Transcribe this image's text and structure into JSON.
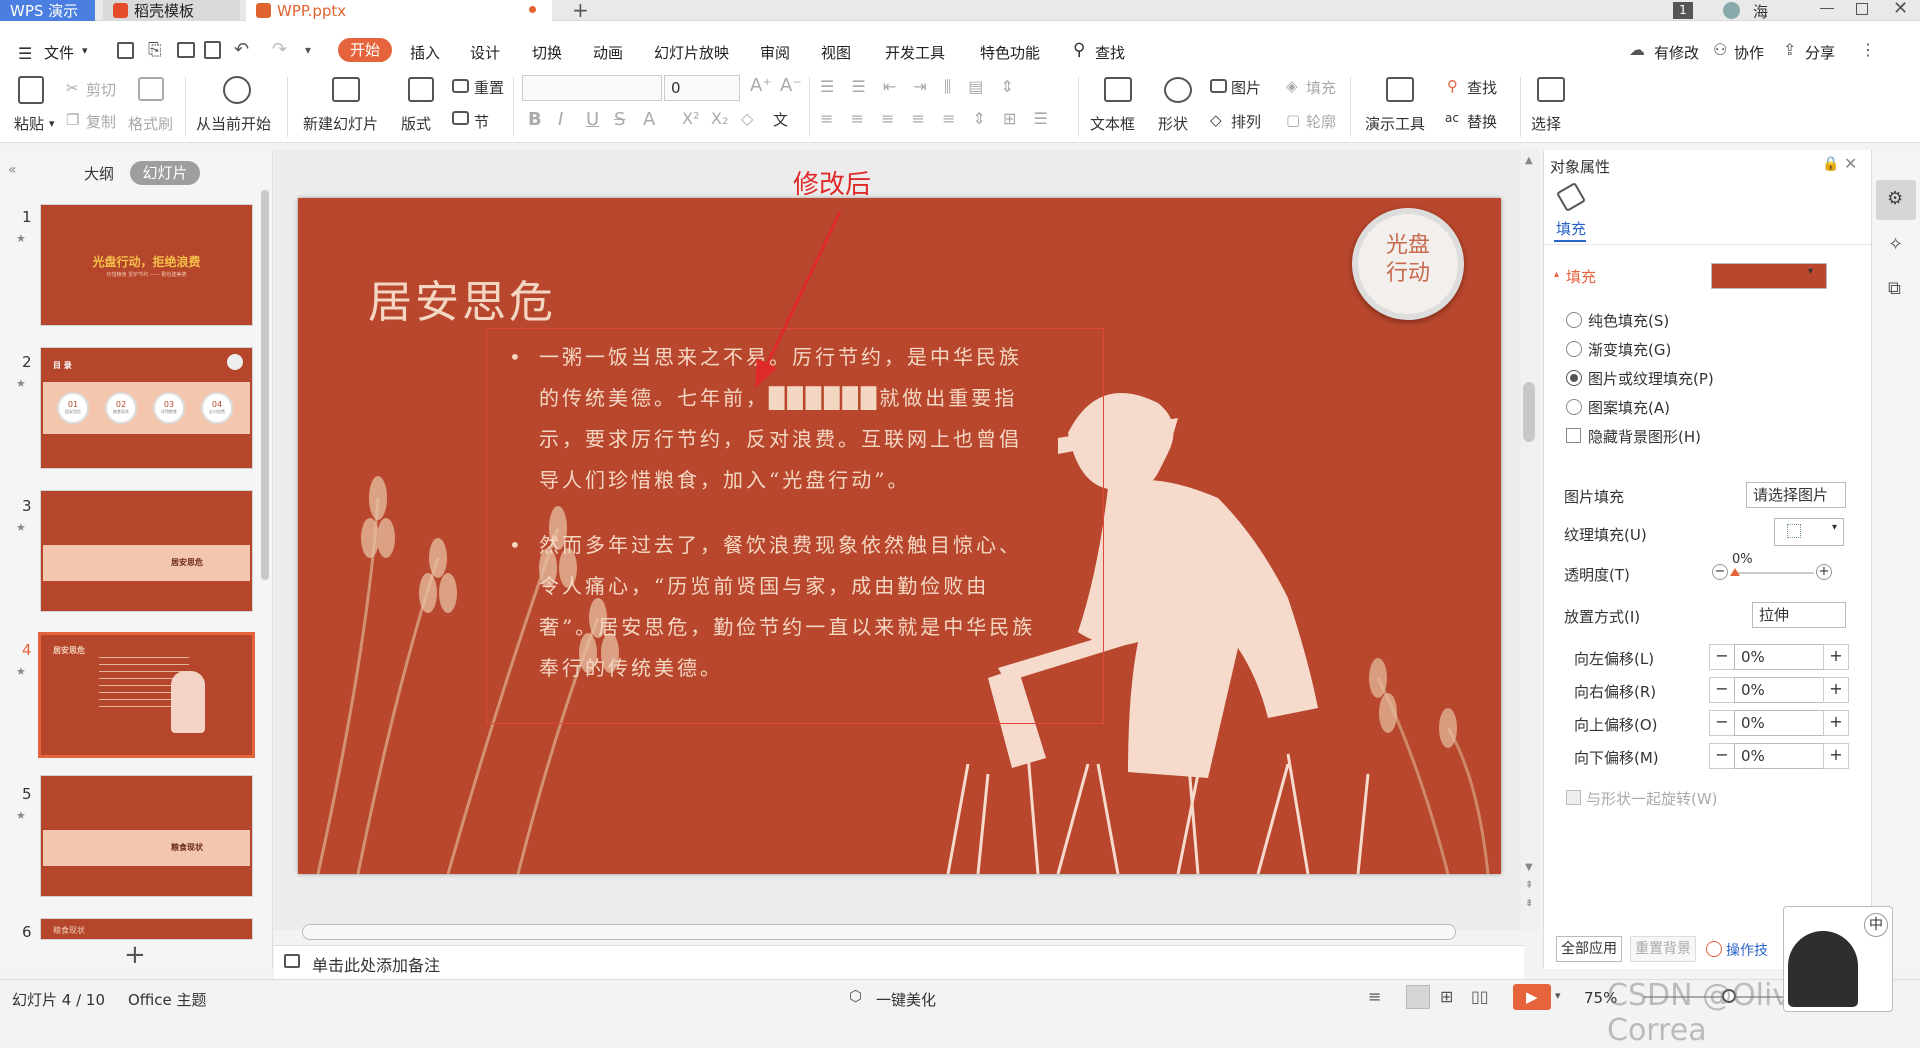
{
  "titlebar": {
    "tab_wps": "WPS 演示",
    "tab_daoke": "稻壳模板",
    "tab_wpp": "WPP.pptx",
    "page_badge": "1",
    "user": "海"
  },
  "menu": {
    "file": "文件",
    "start": "开始",
    "insert": "插入",
    "design": "设计",
    "switch": "切换",
    "animation": "动画",
    "slideshow": "幻灯片放映",
    "review": "审阅",
    "view": "视图",
    "devtools": "开发工具",
    "special": "特色功能",
    "search": "查找",
    "modified": "有修改",
    "collab": "协作",
    "share": "分享"
  },
  "ribbon": {
    "paste": "粘贴",
    "cut": "剪切",
    "copy": "复制",
    "format_painter": "格式刷",
    "from_current": "从当前开始",
    "new_slide": "新建幻灯片",
    "layout": "版式",
    "reset": "重置",
    "section": "节",
    "font_size": "0",
    "textbox": "文本框",
    "shape": "形状",
    "picture": "图片",
    "fill": "填充",
    "arrange": "排列",
    "outline": "轮廓",
    "present_tools": "演示工具",
    "find": "查找",
    "replace": "替换",
    "select": "选择",
    "text_direction": "文"
  },
  "leftpanel": {
    "tab_outline": "大纲",
    "tab_slides": "幻灯片",
    "slide_numbers": [
      "1",
      "2",
      "3",
      "4",
      "5",
      "6"
    ],
    "thumb1_title": "光盘行动，拒绝浪费",
    "thumb1_sub": "珍惜粮食 爱护节约 —— 勤俭建美德",
    "thumb2_title": "目 录",
    "thumb2_circles": [
      "01",
      "02",
      "03",
      "04"
    ],
    "thumb2_labels": [
      "居安思危",
      "粮食现状",
      "珍惜粮食",
      "反对浪费"
    ],
    "thumb3_text": "居安思危",
    "thumb4_title": "居安思危",
    "thumb5_text": "粮食现状",
    "thumb6_title": "粮食现状"
  },
  "annotation": {
    "label": "修改后"
  },
  "slide": {
    "title": "居安思危",
    "badge": "光盘行动",
    "bullet1": "一粥一饭当思来之不易。厉行节约，是中华民族的传统美德。七年前，██████就做出重要指示，要求厉行节约，反对浪费。互联网上也曾倡导人们珍惜粮食，加入“光盘行动”。",
    "bullet2": "然而多年过去了，餐饮浪费现象依然触目惊心、令人痛心，“历览前贤国与家，成由勤俭败由奢”。居安思危，勤俭节约一直以来就是中华民族奉行的传统美德。"
  },
  "rightpanel": {
    "header": "对象属性",
    "tab_fill": "填充",
    "section_fill": "填充",
    "opt_solid": "纯色填充(S)",
    "opt_gradient": "渐变填充(G)",
    "opt_picture": "图片或纹理填充(P)",
    "opt_pattern": "图案填充(A)",
    "opt_hide_bg": "隐藏背景图形(H)",
    "picture_fill": "图片填充",
    "picture_fill_value": "请选择图片",
    "texture_fill": "纹理填充(U)",
    "transparency": "透明度(T)",
    "transparency_value": "0%",
    "placement": "放置方式(I)",
    "placement_value": "拉伸",
    "offset_left": "向左偏移(L)",
    "offset_right": "向右偏移(R)",
    "offset_up": "向上偏移(O)",
    "offset_down": "向下偏移(M)",
    "offset_value": "0%",
    "rotate_with_shape": "与形状一起旋转(W)",
    "apply_all": "全部应用",
    "reset_bg": "重置背景",
    "tips": "操作技"
  },
  "notes": {
    "placeholder": "单击此处添加备注"
  },
  "status": {
    "slide_count": "幻灯片 4 / 10",
    "theme": "Office 主题",
    "beautify": "一键美化",
    "zoom": "75%",
    "watermark": "CSDN @Oliver Correa",
    "ime": "中"
  },
  "colors": {
    "accent": "#e6643c",
    "slide_bg": "#b8472d",
    "wps_blue": "#4a7ee0"
  }
}
